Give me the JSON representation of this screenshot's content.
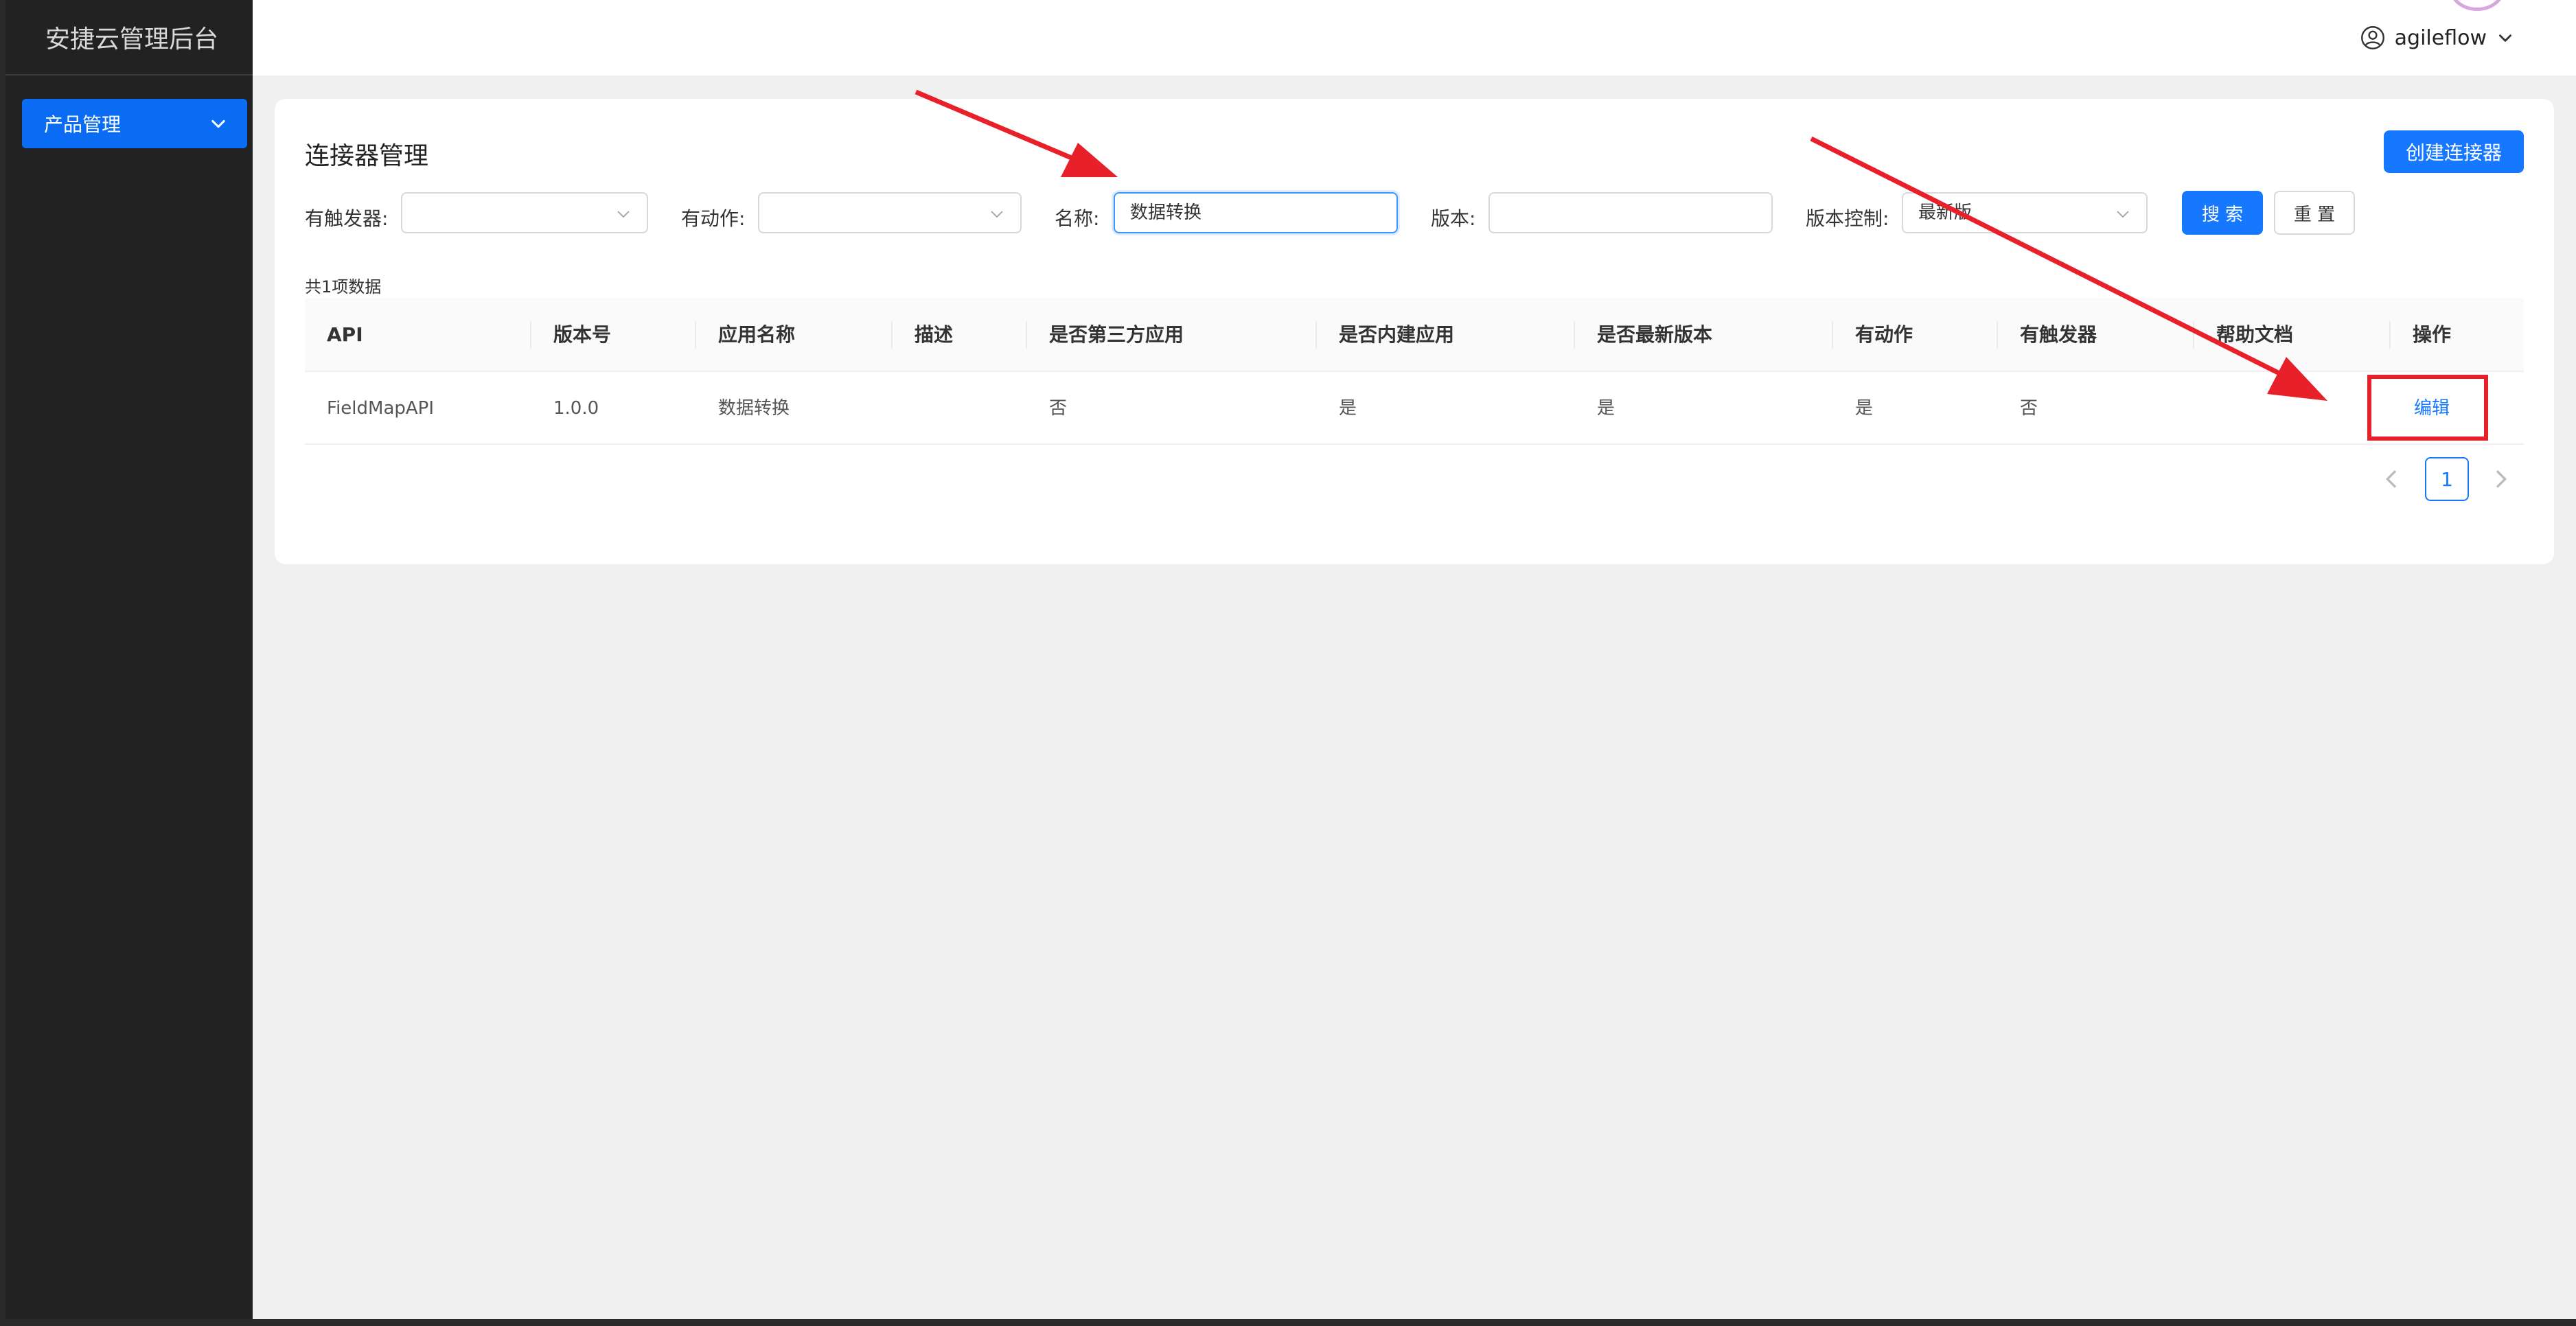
{
  "app": {
    "title": "安捷云管理后台"
  },
  "sidebar": {
    "items": [
      {
        "label": "产品管理",
        "icon": "chevron-down-icon"
      }
    ]
  },
  "header": {
    "username": "agileflow"
  },
  "page": {
    "title": "连接器管理",
    "create_button": "创建连接器",
    "filters": {
      "trigger_label": "有触发器:",
      "trigger_value": "",
      "action_label": "有动作:",
      "action_value": "",
      "name_label": "名称:",
      "name_value": "数据转换",
      "version_label": "版本:",
      "version_value": "",
      "version_control_label": "版本控制:",
      "version_control_value": "最新版"
    },
    "search_button": "搜 索",
    "reset_button": "重 置",
    "total_text": "共1项数据"
  },
  "table": {
    "columns": [
      "API",
      "版本号",
      "应用名称",
      "描述",
      "是否第三方应用",
      "是否内建应用",
      "是否最新版本",
      "有动作",
      "有触发器",
      "帮助文档",
      "操作"
    ],
    "rows": [
      {
        "api": "FieldMapAPI",
        "version": "1.0.0",
        "app_name": "数据转换",
        "desc": "",
        "third_party": "否",
        "builtin": "是",
        "latest": "是",
        "has_action": "是",
        "has_trigger": "否",
        "help_doc": "",
        "operation": "编辑"
      }
    ]
  },
  "pagination": {
    "current": "1"
  },
  "colors": {
    "accent": "#1677ff",
    "sidebar_bg": "#222222",
    "annotation": "#e8202a"
  }
}
